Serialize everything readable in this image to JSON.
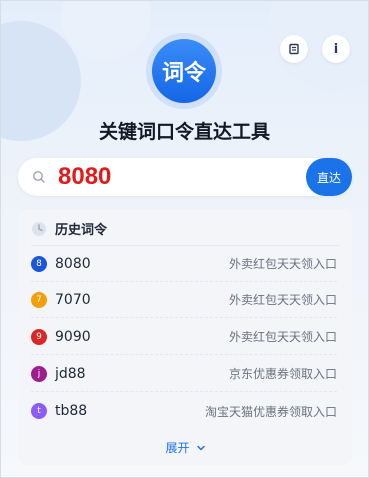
{
  "app": {
    "logo_text": "词令",
    "title": "关键词口令直达工具",
    "action_icons": [
      "document-icon",
      "info-icon"
    ],
    "info_glyph": "i"
  },
  "search": {
    "value": "8080",
    "go_label": "直达"
  },
  "history": {
    "title": "历史词令",
    "items": [
      {
        "badge": "8",
        "code": "8080",
        "desc": "外卖红包天天领入口",
        "color": "#1a56db"
      },
      {
        "badge": "7",
        "code": "7070",
        "desc": "外卖红包天天领入口",
        "color": "#f59e0b"
      },
      {
        "badge": "9",
        "code": "9090",
        "desc": "外卖红包天天领入口",
        "color": "#dc2626"
      },
      {
        "badge": "j",
        "code": "jd88",
        "desc": "京东优惠券领取入口",
        "color": "#9d1e8c"
      },
      {
        "badge": "t",
        "code": "tb88",
        "desc": "淘宝天猫优惠券领取入口",
        "color": "#8b5cf6"
      }
    ],
    "expand_label": "展开"
  },
  "colors": {
    "accent": "#1a73e8",
    "search_value": "#e11a1a"
  }
}
